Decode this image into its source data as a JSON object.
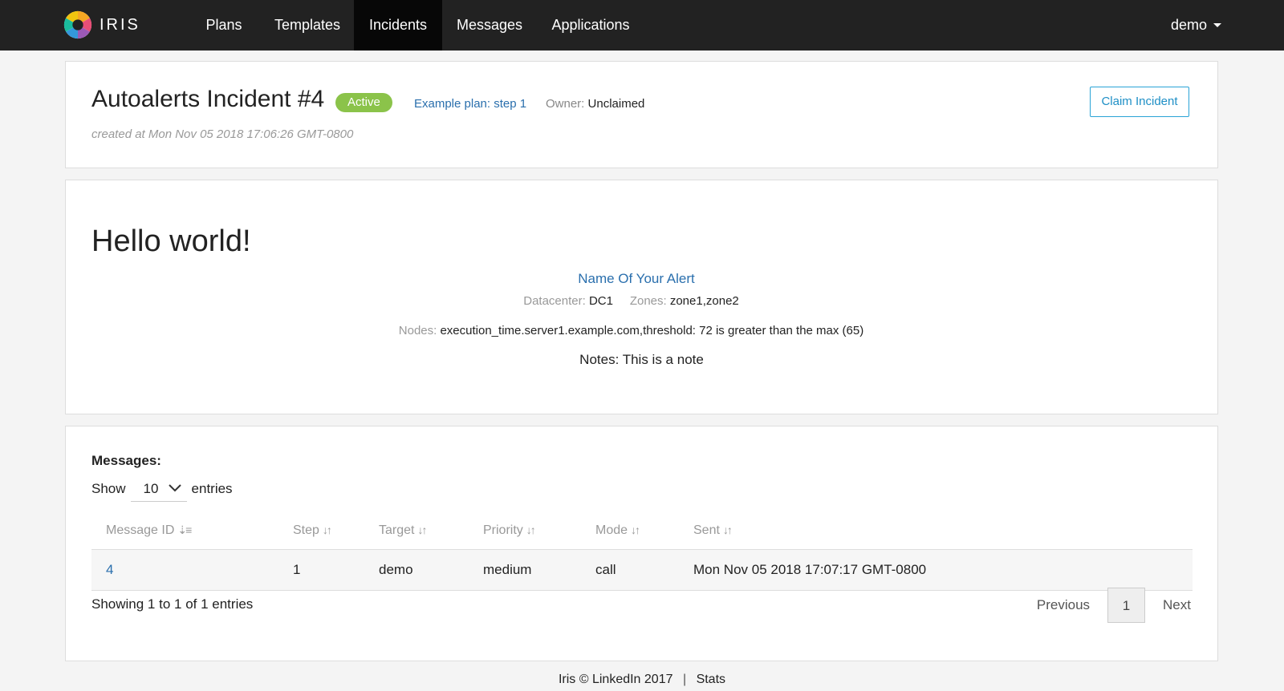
{
  "nav": {
    "brand": "IRIS",
    "items": [
      {
        "label": "Plans",
        "active": false
      },
      {
        "label": "Templates",
        "active": false
      },
      {
        "label": "Incidents",
        "active": true
      },
      {
        "label": "Messages",
        "active": false
      },
      {
        "label": "Applications",
        "active": false
      }
    ],
    "user": "demo"
  },
  "incident": {
    "title": "Autoalerts Incident #4",
    "status": "Active",
    "plan_link": "Example plan: step 1",
    "owner_label": "Owner:",
    "owner_value": "Unclaimed",
    "created": "created at Mon Nov 05 2018 17:06:26 GMT-0800",
    "claim_button": "Claim Incident"
  },
  "context": {
    "heading": "Hello world!",
    "alert_name": "Name Of Your Alert",
    "datacenter_label": "Datacenter:",
    "datacenter_value": "DC1",
    "zones_label": "Zones:",
    "zones_value": "zone1,zone2",
    "nodes_label": "Nodes:",
    "nodes_value": "execution_time.server1.example.com,threshold: 72 is greater than the max (65)",
    "notes": "Notes: This is a note"
  },
  "messages": {
    "heading": "Messages:",
    "show_label": "Show",
    "page_length": "10",
    "entries_label": "entries",
    "columns": [
      "Message ID",
      "Step",
      "Target",
      "Priority",
      "Mode",
      "Sent"
    ],
    "rows": [
      {
        "id": "4",
        "step": "1",
        "target": "demo",
        "priority": "medium",
        "mode": "call",
        "sent": "Mon Nov 05 2018 17:07:17 GMT-0800"
      }
    ],
    "info": "Showing 1 to 1 of 1 entries",
    "pagination": {
      "previous": "Previous",
      "current": "1",
      "next": "Next"
    }
  },
  "footer": {
    "copyright": "Iris © LinkedIn 2017",
    "separator": "|",
    "stats_link": "Stats"
  },
  "colors": {
    "navbar": "#222222",
    "active_badge": "#8bc34a",
    "link": "#2a6fad",
    "claim_button": "#2aa3d6"
  }
}
